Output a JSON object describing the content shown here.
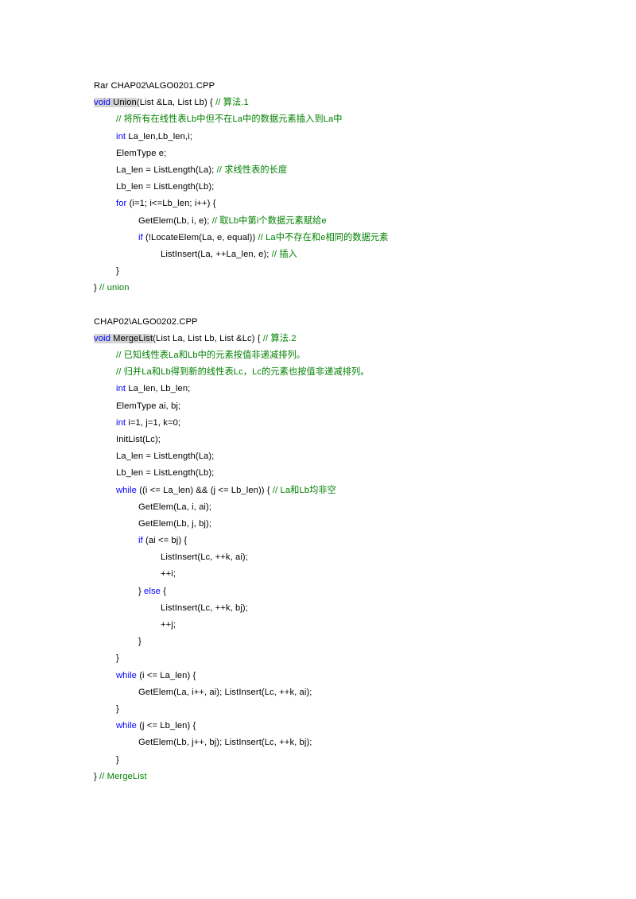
{
  "document": {
    "type": "source-code-listing",
    "language": "C++",
    "colors": {
      "keyword": "#0000ff",
      "comment": "#008000",
      "text": "#000000",
      "highlight_background": "#d4d4d4",
      "page_background": "#ffffff"
    }
  },
  "sections": [
    {
      "id": "section-1",
      "file_header": "Rar CHAP02\\ALGO0201.CPP",
      "lines": [
        {
          "indent": 0,
          "tokens": [
            {
              "t": "void ",
              "c": "highlight-keyword"
            },
            {
              "t": "Union",
              "c": "highlight-function"
            },
            {
              "t": "(List &La, List Lb) { ",
              "c": "plain"
            },
            {
              "t": "// 算法.1",
              "c": "comment"
            }
          ]
        },
        {
          "indent": 1,
          "tokens": [
            {
              "t": "// 将所有在线性表Lb中但不在La中的数据元素插入到La中",
              "c": "comment"
            }
          ]
        },
        {
          "indent": 1,
          "tokens": [
            {
              "t": "int",
              "c": "keyword"
            },
            {
              "t": " La_len,Lb_len,i;",
              "c": "plain"
            }
          ]
        },
        {
          "indent": 1,
          "tokens": [
            {
              "t": "ElemType e;",
              "c": "plain"
            }
          ]
        },
        {
          "indent": 1,
          "tokens": [
            {
              "t": "La_len = ListLength(La); ",
              "c": "plain"
            },
            {
              "t": "// 求线性表的长度",
              "c": "comment"
            }
          ]
        },
        {
          "indent": 1,
          "tokens": [
            {
              "t": "Lb_len = ListLength(Lb);",
              "c": "plain"
            }
          ]
        },
        {
          "indent": 1,
          "tokens": [
            {
              "t": "for",
              "c": "keyword"
            },
            {
              "t": " (i=1; i<=Lb_len; i++) {",
              "c": "plain"
            }
          ]
        },
        {
          "indent": 2,
          "tokens": [
            {
              "t": "GetElem(Lb, i, e); ",
              "c": "plain"
            },
            {
              "t": "// 取Lb中第i个数据元素赋给e",
              "c": "comment"
            }
          ]
        },
        {
          "indent": 2,
          "tokens": [
            {
              "t": "if",
              "c": "keyword"
            },
            {
              "t": " (!LocateElem(La, e, equal)) ",
              "c": "plain"
            },
            {
              "t": "// La中不存在和e相同的数据元素",
              "c": "comment"
            }
          ]
        },
        {
          "indent": 3,
          "tokens": [
            {
              "t": "ListInsert(La, ++La_len, e); ",
              "c": "plain"
            },
            {
              "t": "// 插入",
              "c": "comment"
            }
          ]
        },
        {
          "indent": 1,
          "tokens": [
            {
              "t": "}",
              "c": "plain"
            }
          ]
        },
        {
          "indent": 0,
          "tokens": [
            {
              "t": "} ",
              "c": "plain"
            },
            {
              "t": "// union",
              "c": "comment"
            }
          ]
        }
      ]
    },
    {
      "id": "section-2",
      "file_header": "CHAP02\\ALGO0202.CPP",
      "lines": [
        {
          "indent": 0,
          "tokens": [
            {
              "t": "void ",
              "c": "highlight-keyword"
            },
            {
              "t": "MergeList",
              "c": "highlight-function"
            },
            {
              "t": "(List La, List Lb, List &Lc) { ",
              "c": "plain"
            },
            {
              "t": "// 算法.2",
              "c": "comment"
            }
          ]
        },
        {
          "indent": 1,
          "tokens": [
            {
              "t": "// 已知线性表La和Lb中的元素按值非递减排列。",
              "c": "comment"
            }
          ]
        },
        {
          "indent": 1,
          "tokens": [
            {
              "t": "// 归并La和Lb得到新的线性表Lc，Lc的元素也按值非递减排列。",
              "c": "comment"
            }
          ]
        },
        {
          "indent": 1,
          "tokens": [
            {
              "t": "int",
              "c": "keyword"
            },
            {
              "t": " La_len, Lb_len;",
              "c": "plain"
            }
          ]
        },
        {
          "indent": 1,
          "tokens": [
            {
              "t": "ElemType ai, bj;",
              "c": "plain"
            }
          ]
        },
        {
          "indent": 1,
          "tokens": [
            {
              "t": "int",
              "c": "keyword"
            },
            {
              "t": " i=1, j=1, k=0;",
              "c": "plain"
            }
          ]
        },
        {
          "indent": 1,
          "tokens": [
            {
              "t": "InitList(Lc);",
              "c": "plain"
            }
          ]
        },
        {
          "indent": 1,
          "tokens": [
            {
              "t": "La_len = ListLength(La);",
              "c": "plain"
            }
          ]
        },
        {
          "indent": 1,
          "tokens": [
            {
              "t": "Lb_len = ListLength(Lb);",
              "c": "plain"
            }
          ]
        },
        {
          "indent": 1,
          "tokens": [
            {
              "t": "while",
              "c": "keyword"
            },
            {
              "t": " ((i <= La_len) && (j <= Lb_len)) { ",
              "c": "plain"
            },
            {
              "t": "// La和Lb均非空",
              "c": "comment"
            }
          ]
        },
        {
          "indent": 2,
          "tokens": [
            {
              "t": "GetElem(La, i, ai);",
              "c": "plain"
            }
          ]
        },
        {
          "indent": 2,
          "tokens": [
            {
              "t": "GetElem(Lb, j, bj);",
              "c": "plain"
            }
          ]
        },
        {
          "indent": 2,
          "tokens": [
            {
              "t": "if",
              "c": "keyword"
            },
            {
              "t": " (ai <= bj) {",
              "c": "plain"
            }
          ]
        },
        {
          "indent": 3,
          "tokens": [
            {
              "t": "ListInsert(Lc, ++k, ai);",
              "c": "plain"
            }
          ]
        },
        {
          "indent": 3,
          "tokens": [
            {
              "t": "++i;",
              "c": "plain"
            }
          ]
        },
        {
          "indent": 2,
          "tokens": [
            {
              "t": "} ",
              "c": "plain"
            },
            {
              "t": "else",
              "c": "keyword"
            },
            {
              "t": " {",
              "c": "plain"
            }
          ]
        },
        {
          "indent": 3,
          "tokens": [
            {
              "t": "ListInsert(Lc, ++k, bj);",
              "c": "plain"
            }
          ]
        },
        {
          "indent": 3,
          "tokens": [
            {
              "t": "++j;",
              "c": "plain"
            }
          ]
        },
        {
          "indent": 2,
          "tokens": [
            {
              "t": "}",
              "c": "plain"
            }
          ]
        },
        {
          "indent": 1,
          "tokens": [
            {
              "t": "}",
              "c": "plain"
            }
          ]
        },
        {
          "indent": 1,
          "tokens": [
            {
              "t": "while",
              "c": "keyword"
            },
            {
              "t": " (i <= La_len) {",
              "c": "plain"
            }
          ]
        },
        {
          "indent": 2,
          "tokens": [
            {
              "t": "GetElem(La, i++, ai); ListInsert(Lc, ++k, ai);",
              "c": "plain"
            }
          ]
        },
        {
          "indent": 1,
          "tokens": [
            {
              "t": "}",
              "c": "plain"
            }
          ]
        },
        {
          "indent": 1,
          "tokens": [
            {
              "t": "while",
              "c": "keyword"
            },
            {
              "t": " (j <= Lb_len) {",
              "c": "plain"
            }
          ]
        },
        {
          "indent": 2,
          "tokens": [
            {
              "t": "GetElem(Lb, j++, bj); ListInsert(Lc, ++k, bj);",
              "c": "plain"
            }
          ]
        },
        {
          "indent": 1,
          "tokens": [
            {
              "t": "}",
              "c": "plain"
            }
          ]
        },
        {
          "indent": 0,
          "tokens": [
            {
              "t": "} ",
              "c": "plain"
            },
            {
              "t": "// MergeList",
              "c": "comment"
            }
          ]
        }
      ]
    }
  ]
}
